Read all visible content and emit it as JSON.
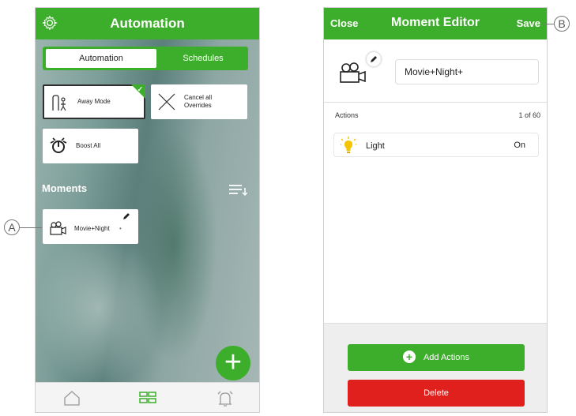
{
  "left_screen": {
    "header": {
      "title": "Automation",
      "settings_icon": "gear-icon"
    },
    "tabs": [
      {
        "label": "Automation",
        "selected": true
      },
      {
        "label": "Schedules",
        "selected": false
      }
    ],
    "automation_cards": [
      {
        "label": "Away Mode",
        "icon": "away-mode-icon",
        "active": true
      },
      {
        "label": "Cancel all Overrides",
        "icon": "close-icon"
      },
      {
        "label": "Boost All",
        "icon": "boost-icon"
      }
    ],
    "moments_section": {
      "title": "Moments",
      "sort_icon": "sort-icon"
    },
    "moments": [
      {
        "label": "Movie+Night",
        "icon": "movie-camera-icon",
        "edit_icon": "pencil-icon"
      }
    ],
    "fab_icon": "plus-icon",
    "bottom_nav": [
      {
        "icon": "home-icon"
      },
      {
        "icon": "automation-grid-icon",
        "selected": true
      },
      {
        "icon": "alarm-bell-icon"
      }
    ]
  },
  "right_screen": {
    "header": {
      "close_label": "Close",
      "title": "Moment Editor",
      "save_label": "Save"
    },
    "moment_name": "Movie+Night+",
    "actions_label": "Actions",
    "actions_count": "1 of 60",
    "actions": [
      {
        "name": "Light",
        "value": "On",
        "icon": "light-bulb-icon"
      }
    ],
    "add_actions_label": "Add Actions",
    "delete_label": "Delete"
  },
  "callouts": {
    "a": "A",
    "b": "B"
  },
  "colors": {
    "brand_green": "#3dae2b",
    "delete_red": "#e0201c"
  }
}
